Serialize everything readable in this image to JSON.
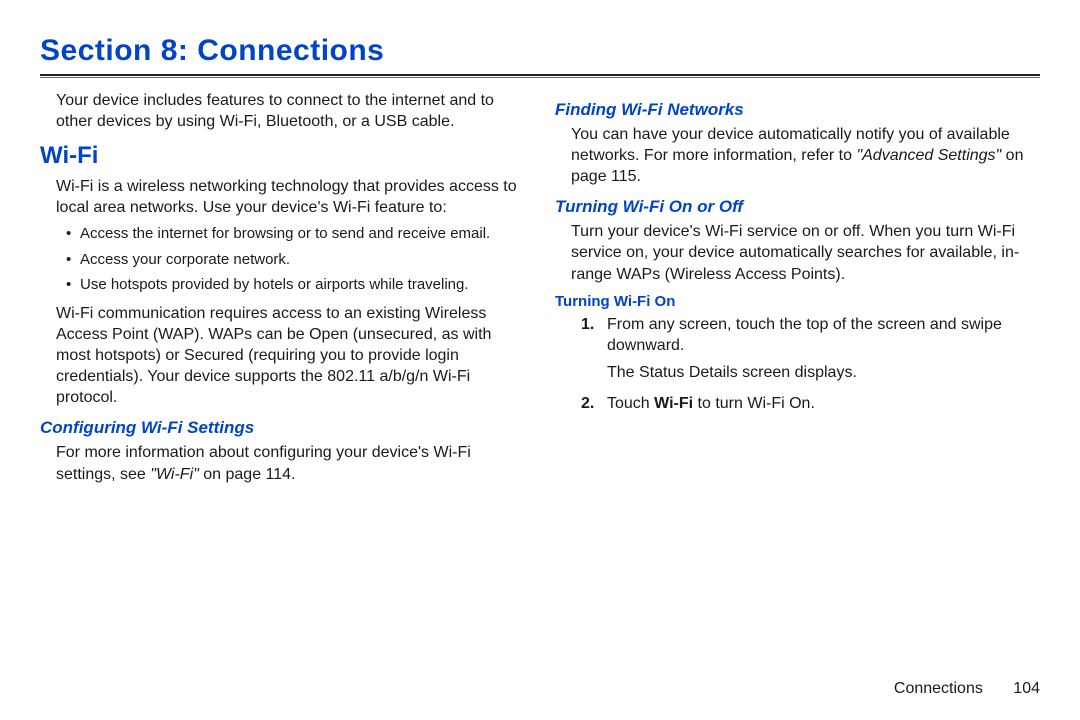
{
  "section_title": "Section 8: Connections",
  "intro": "Your device includes features to connect to the internet and to other devices by using Wi-Fi, Bluetooth, or a USB cable.",
  "wifi_heading": "Wi-Fi",
  "wifi_intro": "Wi-Fi is a wireless networking technology that provides access to local area networks. Use your device's Wi-Fi feature to:",
  "wifi_bullets": [
    "Access the internet for browsing or to send and receive email.",
    "Access your corporate network.",
    "Use hotspots provided by hotels or airports while traveling."
  ],
  "wifi_para2": "Wi-Fi communication requires access to an existing Wireless Access Point (WAP). WAPs can be Open (unsecured, as with most hotspots) or Secured (requiring you to provide login credentials). Your device supports the 802.11 a/b/g/n Wi-Fi protocol.",
  "configuring_heading": "Configuring Wi-Fi Settings",
  "configuring_p_pre": "For more information about configuring your device's Wi-Fi settings, see ",
  "configuring_ref_italic": "\"Wi-Fi\"",
  "configuring_p_post": " on page 114.",
  "finding_heading": "Finding Wi-Fi Networks",
  "finding_p_pre": "You can have your device automatically notify you of available networks. For more information, refer to ",
  "finding_ref_italic": "\"Advanced Settings\"",
  "finding_p_post": " on page 115.",
  "turning_heading": "Turning Wi-Fi On or Off",
  "turning_para": "Turn your device's Wi-Fi service on or off. When you turn Wi-Fi service on, your device automatically searches for available, in-range WAPs (Wireless Access Points).",
  "turning_on_heading": "Turning Wi-Fi On",
  "step1_line1": "From any screen, touch the top of the screen and swipe downward.",
  "step1_line2": "The Status Details screen displays.",
  "step2_pre": "Touch ",
  "step2_bold": "Wi-Fi",
  "step2_post": " to turn Wi-Fi On.",
  "footer_label": "Connections",
  "footer_page": "104"
}
